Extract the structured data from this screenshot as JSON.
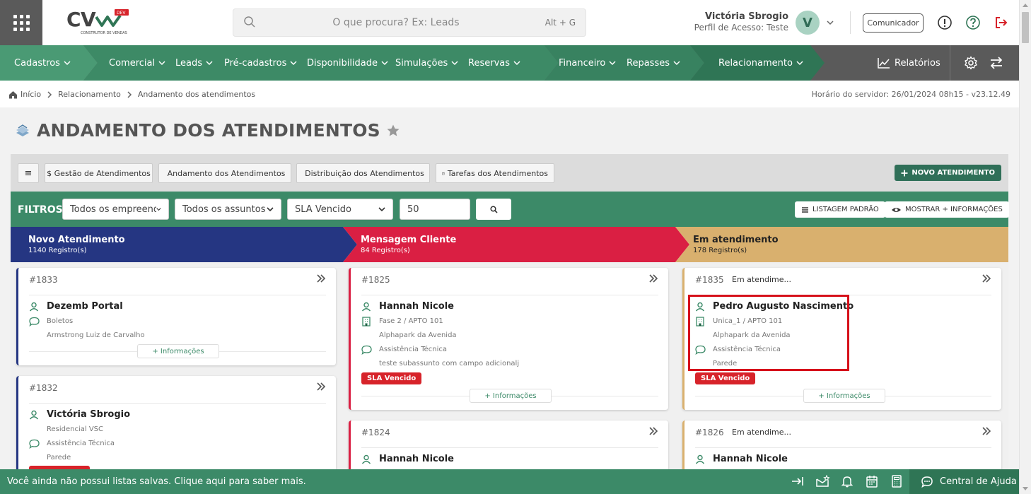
{
  "header": {
    "logo_text": "CV",
    "logo_badge": "DEV",
    "logo_sub": "CONSTRUTOR DE VENDAS",
    "search": {
      "placeholder": "O que procura? Ex: Leads",
      "shortcut": "Alt + G"
    },
    "user": {
      "name": "Victória Sbrogio",
      "profile": "Perfil de Acesso: Teste",
      "initial": "V"
    },
    "comunicador_label": "Comunicador"
  },
  "nav": {
    "items": [
      {
        "label": "Cadastros"
      },
      {
        "label": "Comercial"
      },
      {
        "label": "Leads"
      },
      {
        "label": "Pré-cadastros"
      },
      {
        "label": "Disponibilidade"
      },
      {
        "label": "Simulações"
      },
      {
        "label": "Reservas"
      },
      {
        "label": "Financeiro"
      },
      {
        "label": "Repasses"
      },
      {
        "label": "Relacionamento"
      }
    ],
    "reports_label": "Relatórios"
  },
  "breadcrumb": {
    "home": "Início",
    "level1": "Relacionamento",
    "level2": "Andamento dos atendimentos",
    "server_time": "Horário do servidor: 26/01/2024 08h15 - v23.12.49"
  },
  "page": {
    "title": "ANDAMENTO DOS ATENDIMENTOS"
  },
  "toolbar": {
    "menu_label": "≡",
    "tabs": [
      {
        "label": "$ Gestão de Atendimentos"
      },
      {
        "label": "Andamento dos Atendimentos"
      },
      {
        "label": "Distribuição dos Atendimentos"
      },
      {
        "label": "Tarefas dos Atendimentos"
      }
    ],
    "new_label": "NOVO ATENDIMENTO"
  },
  "filters": {
    "label": "FILTROS",
    "enterprise": "Todos os empreendimentos",
    "subject": "Todos os assuntos",
    "sla": "SLA Vencido",
    "limit": "50",
    "list_default": "LISTAGEM PADRÃO",
    "show_more": "MOSTRAR + INFORMAÇÕES"
  },
  "columns": [
    {
      "title": "Novo Atendimento",
      "count": "1140 Registro(s)",
      "color": "#253682",
      "cards": [
        {
          "id": "#1833",
          "name": "Dezemb Portal",
          "line1": "Boletos",
          "line2": "Armstrong Luiz de Carvalho",
          "more": "+ Informações"
        },
        {
          "id": "#1832",
          "name": "Victória Sbrogio",
          "line1": "Residencial VSC",
          "line2": "Assistência Técnica",
          "line3": "Parede"
        }
      ]
    },
    {
      "title": "Mensagem Cliente",
      "count": "84 Registro(s)",
      "color": "#da1f43",
      "cards": [
        {
          "id": "#1825",
          "name": "Hannah Nicole",
          "unit": "Fase 2 / APTO 101",
          "enterprise": "Alphapark da Avenida",
          "subject": "Assistência Técnica",
          "detail": "teste subassunto com campo adicionalj",
          "sla": "SLA Vencido",
          "more": "+ Informações"
        },
        {
          "id": "#1824",
          "name": "Hannah Nicole"
        }
      ]
    },
    {
      "title": "Em atendimento",
      "count": "178 Registro(s)",
      "color": "#d9b06e",
      "cards": [
        {
          "id": "#1835",
          "status": "Em atendime...",
          "name": "Pedro Augusto Nascimento",
          "unit": "Unica_1 / APTO 101",
          "enterprise": "Alphapark da Avenida",
          "subject": "Assistência Técnica",
          "detail": "Parede",
          "sla": "SLA Vencido",
          "more": "+ Informações"
        },
        {
          "id": "#1826",
          "status": "Em atendime...",
          "name": "Hannah Nicole"
        }
      ]
    }
  ],
  "footer": {
    "message": "Você ainda não possui listas salvas. Clique aqui para saber mais.",
    "help_label": "Central de Ajuda"
  },
  "colors": {
    "brand_green": "#3c8a68",
    "dark_green": "#2f7555",
    "sla_red": "#d7232a"
  }
}
